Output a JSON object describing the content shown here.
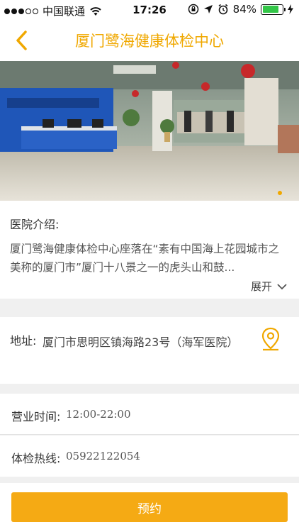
{
  "status_bar": {
    "carrier": "中国联通",
    "time": "17:26",
    "battery": "84%",
    "battery_level": 0.84,
    "icons": [
      "signal-dots-icon",
      "wifi-icon",
      "rotation-lock-icon",
      "location-arrow-icon",
      "alarm-icon",
      "battery-icon",
      "charging-bolt-icon"
    ]
  },
  "nav": {
    "title": "厦门鹭海健康体检中心",
    "accent_color": "#f0a800"
  },
  "intro": {
    "label": "医院介绍:",
    "text": "厦门鹭海健康体检中心座落在“素有中国海上花园城市之美称的厦门市”厦门十八景之一的虎头山和鼓...",
    "expand_label": "展开"
  },
  "address": {
    "label": "地址:",
    "value": "厦门市思明区镇海路23号（海军医院）"
  },
  "hours": {
    "label": "营业时间:",
    "value": "12:00-22:00"
  },
  "hotline": {
    "label": "体检热线:",
    "value": "05922122054"
  },
  "action": {
    "book_label": "预约",
    "button_color": "#f5aa14"
  }
}
